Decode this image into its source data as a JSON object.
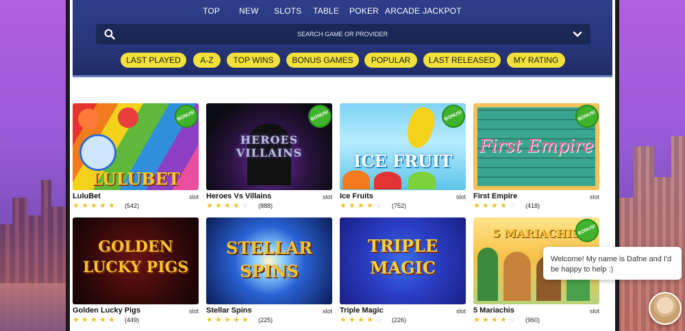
{
  "nav": [
    "TOP",
    "NEW",
    "SLOTS",
    "TABLE",
    "POKER",
    "ARCADE",
    "JACKPOT"
  ],
  "search": {
    "placeholder": "SEARCH GAME OR PROVIDER",
    "icon": "search-icon",
    "dropdown_icon": "chevron-down-icon"
  },
  "filters": [
    "LAST PLAYED",
    "A-Z",
    "TOP WINS",
    "BONUS GAMES",
    "POPULAR",
    "LAST RELEASED",
    "MY RATING"
  ],
  "bonus_badge": "BONUS!",
  "games": [
    {
      "name": "LuluBet",
      "art": "LULUBET",
      "type": "slot",
      "rating": 5,
      "count": "(542)",
      "bonus": true
    },
    {
      "name": "Heroes Vs Villains",
      "art": "HEROES VILLAINS",
      "type": "slot",
      "rating": 4,
      "count": "(888)",
      "bonus": true
    },
    {
      "name": "Ice Fruits",
      "art": "ICE FRUIT",
      "type": "slot",
      "rating": 4,
      "count": "(752)",
      "bonus": true
    },
    {
      "name": "First Empire",
      "art": "First Empire",
      "type": "slot",
      "rating": 4,
      "count": "(418)",
      "bonus": true
    },
    {
      "name": "Golden Lucky Pigs",
      "art": "GOLDEN LUCKY PIGS",
      "type": "slot",
      "rating": 5,
      "count": "(449)",
      "bonus": false
    },
    {
      "name": "Stellar Spins",
      "art": "STELLAR SPINS",
      "type": "slot",
      "rating": 5,
      "count": "(225)",
      "bonus": false
    },
    {
      "name": "Triple Magic",
      "art": "TRIPLE MAGIC",
      "type": "slot",
      "rating": 4,
      "count": "(226)",
      "bonus": false
    },
    {
      "name": "5 Mariachis",
      "art": "5 MARIACHIS",
      "type": "slot",
      "rating": 4,
      "count": "(960)",
      "bonus": true
    }
  ],
  "chat": {
    "message": "Welcome! My name is Dafne and I'd be happy to help :)"
  },
  "colors": {
    "header": "#2e3f8a",
    "pill": "#f1e13a",
    "star": "#ecc12c",
    "bonus": "#3fb32c"
  }
}
